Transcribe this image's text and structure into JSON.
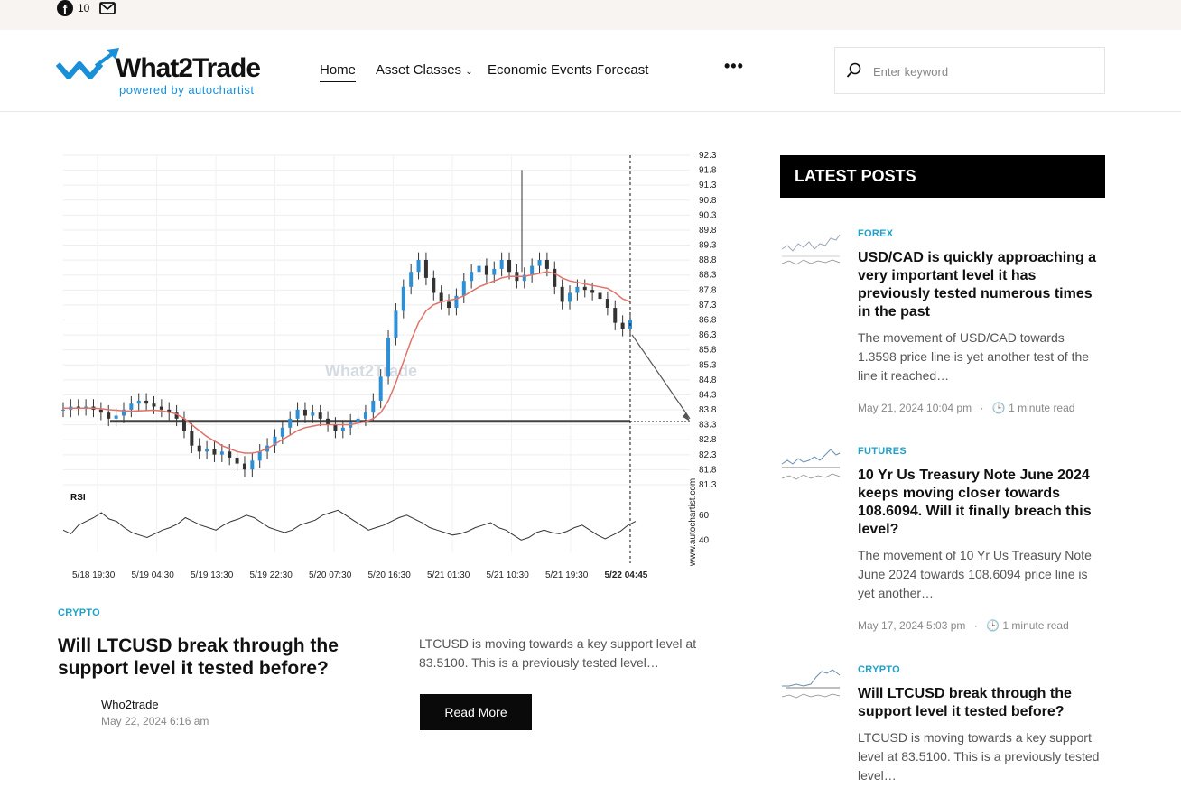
{
  "topbar": {
    "facebook_count": "10"
  },
  "header": {
    "logo_text": "What2Trade",
    "logo_sub": "powered by autochartist",
    "nav": {
      "home": "Home",
      "asset_classes": "Asset Classes",
      "events": "Economic Events Forecast",
      "more": "•••"
    },
    "search_placeholder": "Enter keyword"
  },
  "main_post": {
    "category": "CRYPTO",
    "title": "Will LTCUSD break through the support level it tested before?",
    "excerpt": "LTCUSD is moving towards a key support level at 83.5100. This is a previously tested level…",
    "author": "Who2trade",
    "date": "May 22, 2024 6:16 am",
    "read_more": "Read More"
  },
  "chart_data": {
    "type": "candlestick",
    "symbol": "LTCUSD",
    "watermark": "What2Trade",
    "vendor": "www.autochartist.com",
    "y_ticks": [
      "92.3945",
      "91.8945",
      "91.3945",
      "90.8945",
      "90.3945",
      "89.8945",
      "89.3945",
      "88.8945",
      "88.3945",
      "87.8945",
      "87.3945",
      "86.8945",
      "86.3945",
      "85.8945",
      "85.3945",
      "84.8945",
      "84.3945",
      "83.8945",
      "83.3945",
      "82.8945",
      "82.3945",
      "81.8945",
      "81.3945"
    ],
    "x_ticks": [
      "5/18 19:30",
      "5/19 04:30",
      "5/19 13:30",
      "5/19 22:30",
      "5/20 07:30",
      "5/20 16:30",
      "5/21 01:30",
      "5/21 10:30",
      "5/21 19:30",
      "5/22 04:45"
    ],
    "close_series": [
      83.9,
      84.0,
      83.95,
      84.0,
      83.9,
      83.8,
      83.6,
      83.7,
      83.9,
      84.1,
      84.2,
      84.1,
      84.0,
      83.9,
      83.8,
      83.6,
      83.2,
      82.7,
      82.5,
      82.6,
      82.4,
      82.5,
      82.3,
      82.1,
      81.9,
      82.2,
      82.5,
      82.7,
      83.0,
      83.3,
      83.6,
      83.9,
      83.7,
      83.8,
      83.6,
      83.4,
      83.2,
      83.3,
      83.5,
      83.6,
      83.8,
      84.2,
      85.0,
      86.3,
      87.2,
      88.0,
      88.5,
      88.9,
      88.3,
      87.8,
      87.5,
      87.3,
      87.7,
      88.2,
      88.5,
      88.7,
      88.4,
      88.6,
      88.9,
      88.5,
      88.2,
      88.4,
      88.7,
      88.9,
      88.6,
      88.0,
      87.5,
      87.8,
      88.0,
      87.9,
      87.8,
      87.6,
      87.3,
      86.8,
      86.6,
      86.9
    ],
    "ma_series": [
      83.95,
      83.95,
      83.95,
      83.95,
      83.95,
      83.93,
      83.9,
      83.88,
      83.86,
      83.85,
      83.86,
      83.87,
      83.88,
      83.86,
      83.82,
      83.75,
      83.6,
      83.4,
      83.2,
      83.0,
      82.85,
      82.7,
      82.6,
      82.5,
      82.45,
      82.45,
      82.5,
      82.6,
      82.75,
      82.9,
      83.05,
      83.2,
      83.3,
      83.35,
      83.4,
      83.4,
      83.4,
      83.4,
      83.4,
      83.45,
      83.5,
      83.6,
      83.8,
      84.2,
      84.8,
      85.5,
      86.2,
      86.8,
      87.2,
      87.4,
      87.5,
      87.55,
      87.6,
      87.7,
      87.85,
      88.0,
      88.1,
      88.2,
      88.3,
      88.35,
      88.35,
      88.35,
      88.4,
      88.45,
      88.5,
      88.45,
      88.3,
      88.2,
      88.15,
      88.1,
      88.05,
      88.0,
      87.95,
      87.8,
      87.6,
      87.5
    ],
    "support_level": 83.51,
    "rsi": {
      "label": "RSI",
      "ticks": [
        "60",
        "40"
      ],
      "values": [
        48,
        45,
        52,
        55,
        58,
        62,
        57,
        55,
        50,
        46,
        44,
        42,
        45,
        48,
        50,
        53,
        58,
        55,
        52,
        50,
        48,
        52,
        55,
        57,
        60,
        58,
        54,
        50,
        48,
        46,
        48,
        52,
        54,
        56,
        60,
        62,
        64,
        60,
        56,
        52,
        48,
        50,
        52,
        55,
        58,
        60,
        57,
        54,
        50,
        48,
        46,
        44,
        45,
        47,
        50,
        52,
        54,
        50,
        48,
        44,
        40,
        42,
        46,
        48,
        46,
        45,
        47,
        50,
        52,
        48,
        44,
        41,
        44,
        47,
        52,
        55
      ]
    }
  },
  "sidebar": {
    "heading": "LATEST POSTS",
    "posts": [
      {
        "category": "FOREX",
        "title": "USD/CAD is quickly approaching a very important level it has previously tested numerous times in the past",
        "excerpt": "The movement of USD/CAD towards 1.3598 price line is yet another test of the line it reached…",
        "date": "May 21, 2024 10:04 pm",
        "read": "1 minute read"
      },
      {
        "category": "FUTURES",
        "title": "10 Yr Us Treasury Note June 2024 keeps moving closer towards 108.6094. Will it finally breach this level?",
        "excerpt": "The movement of 10 Yr Us Treasury Note June 2024 towards 108.6094 price line is yet another…",
        "date": "May 17, 2024 5:03 pm",
        "read": "1 minute read"
      },
      {
        "category": "CRYPTO",
        "title": "Will LTCUSD break through the support level it tested before?",
        "excerpt": "LTCUSD is moving towards a key support level at 83.5100. This is a previously tested level…"
      }
    ]
  }
}
